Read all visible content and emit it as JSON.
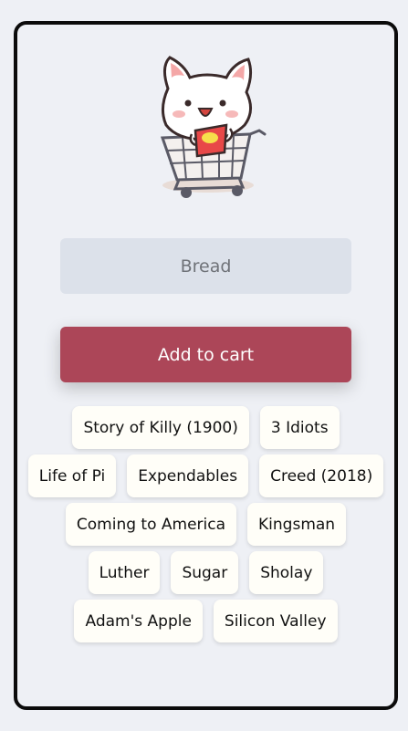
{
  "item_input": {
    "value": "",
    "placeholder": "Bread"
  },
  "add_button": {
    "label": "Add to cart"
  },
  "items": [
    "Story of Killy (1900)",
    "3 Idiots",
    "Life of Pi",
    "Expendables",
    "Creed (2018)",
    "Coming to America",
    "Kingsman",
    "Luther",
    "Sugar",
    "Sholay",
    "Adam's Apple",
    "Silicon Valley"
  ],
  "colors": {
    "background": "#eef0f5",
    "input_background": "#dce1ea",
    "button": "#ac4658",
    "chip": "#fffef8",
    "border": "#0b0b0b"
  },
  "icons": {
    "mascot": "cat-in-shopping-cart-icon"
  }
}
